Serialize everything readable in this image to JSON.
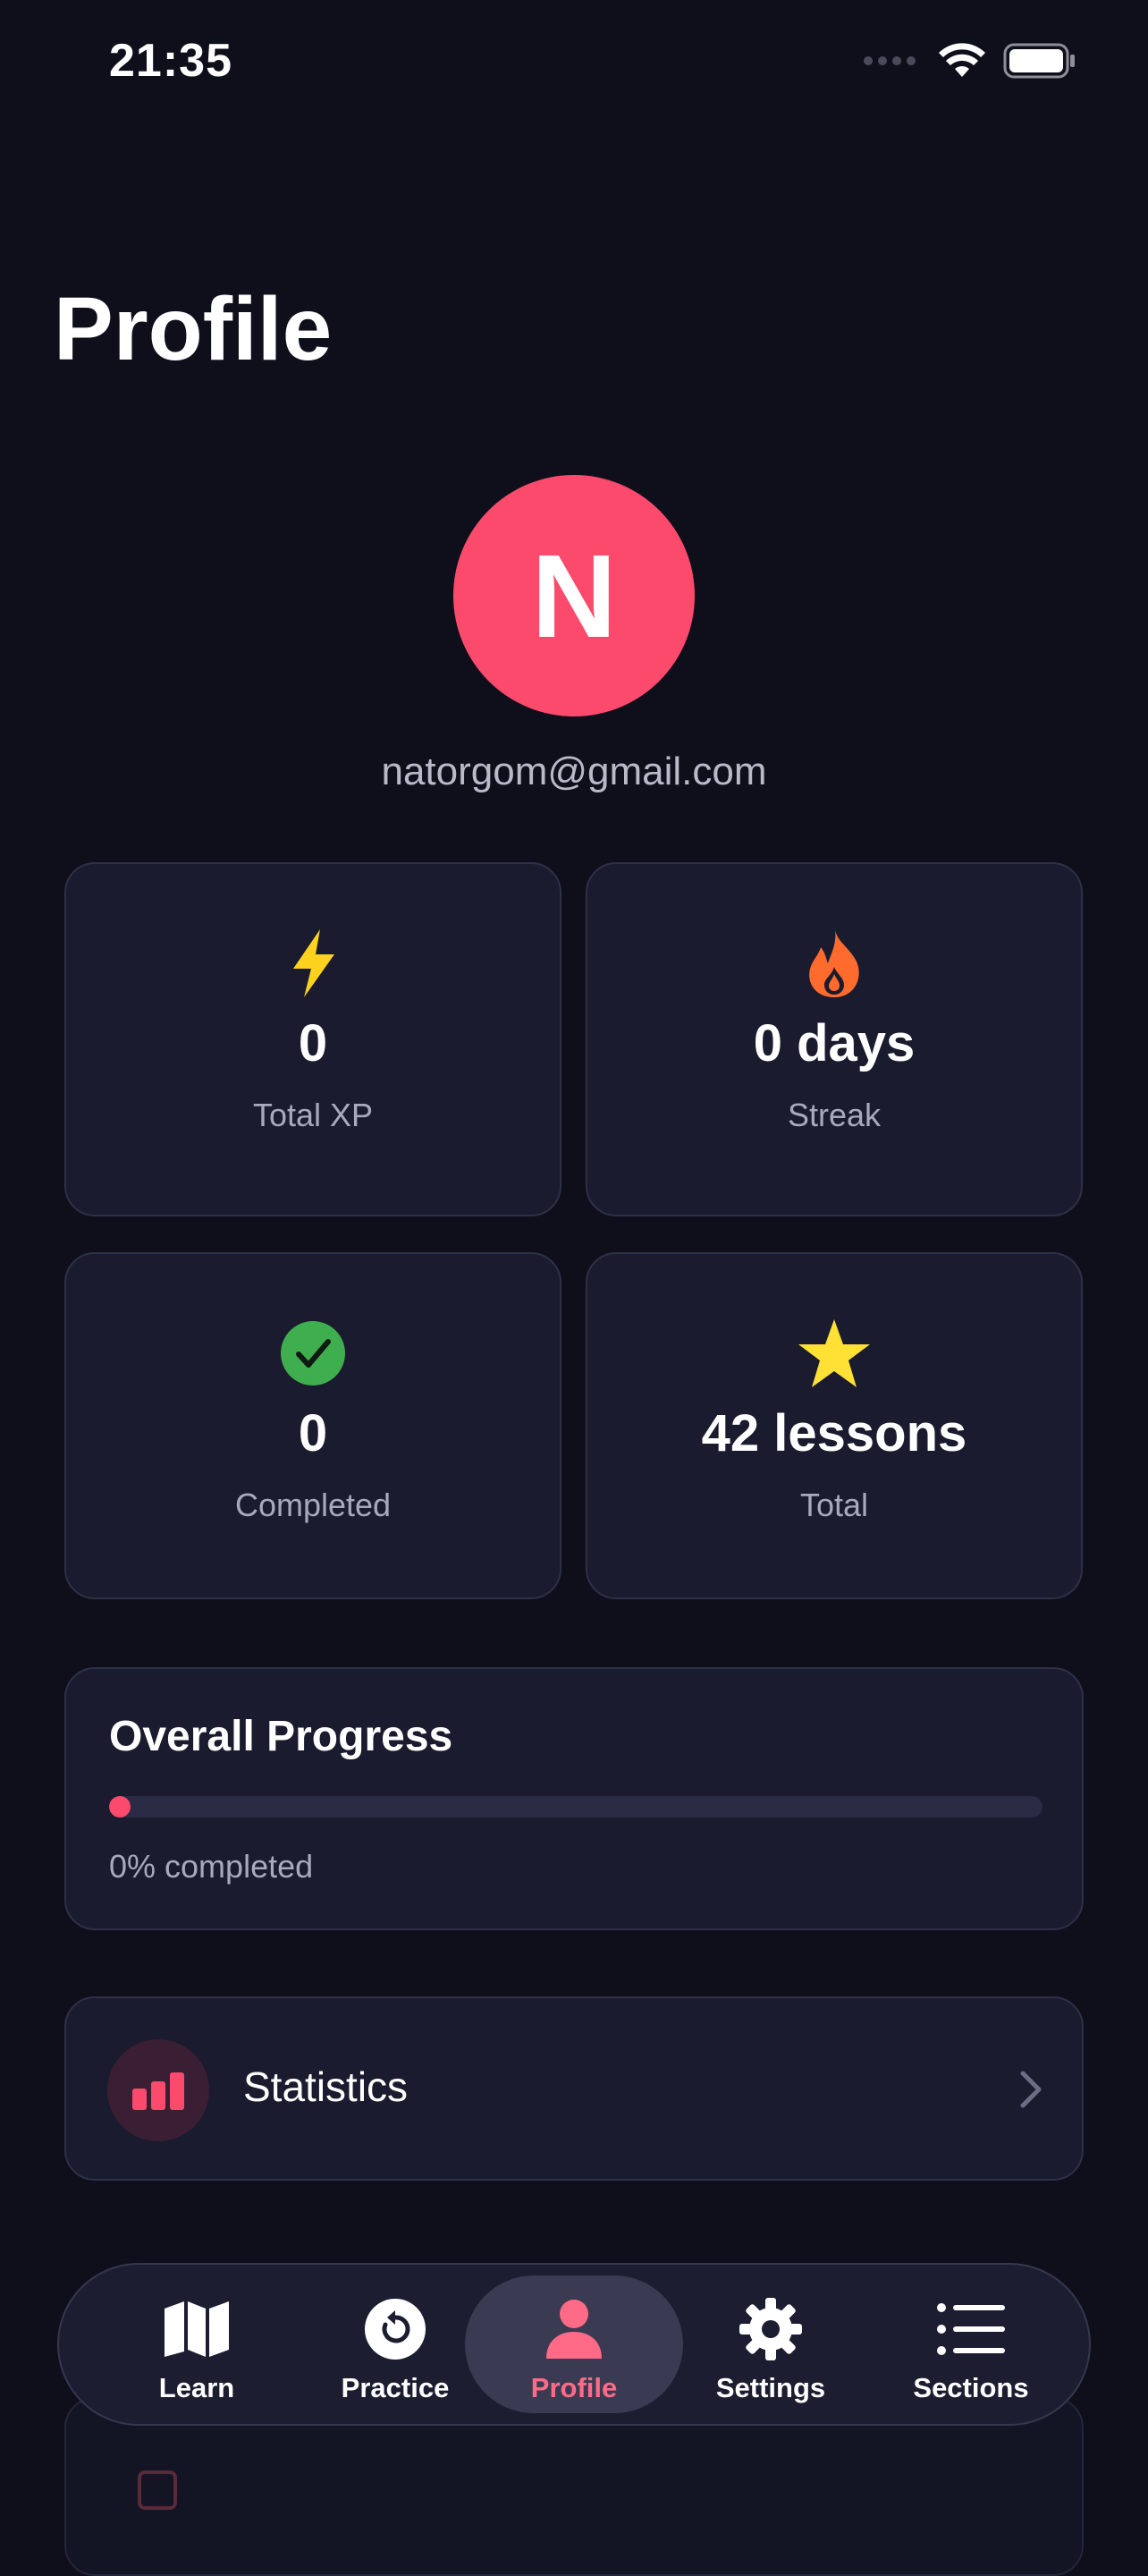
{
  "status_bar": {
    "time": "21:35"
  },
  "header": {
    "title": "Profile"
  },
  "profile": {
    "avatar_initial": "N",
    "email": "natorgom@gmail.com"
  },
  "stats": [
    {
      "value": "0",
      "label": "Total XP",
      "icon": "lightning-icon"
    },
    {
      "value": "0 days",
      "label": "Streak",
      "icon": "flame-icon"
    },
    {
      "value": "0",
      "label": "Completed",
      "icon": "check-circle-icon"
    },
    {
      "value": "42 lessons",
      "label": "Total",
      "icon": "star-icon"
    }
  ],
  "progress": {
    "title": "Overall Progress",
    "percent": 0,
    "text": "0% completed"
  },
  "statistics_row": {
    "label": "Statistics",
    "icon": "bar-chart-icon"
  },
  "tab_bar": {
    "items": [
      {
        "label": "Learn",
        "icon": "map-icon"
      },
      {
        "label": "Practice",
        "icon": "practice-icon"
      },
      {
        "label": "Profile",
        "icon": "person-icon"
      },
      {
        "label": "Settings",
        "icon": "gear-icon"
      },
      {
        "label": "Sections",
        "icon": "list-icon"
      }
    ],
    "active_index": 2
  },
  "colors": {
    "background": "#0f0f1c",
    "card": "#1a1b2e",
    "accent": "#fb4a6c",
    "xp": "#ffd21f",
    "streak": "#ff6b2c",
    "completed": "#3fae4f",
    "star": "#ffe135"
  }
}
